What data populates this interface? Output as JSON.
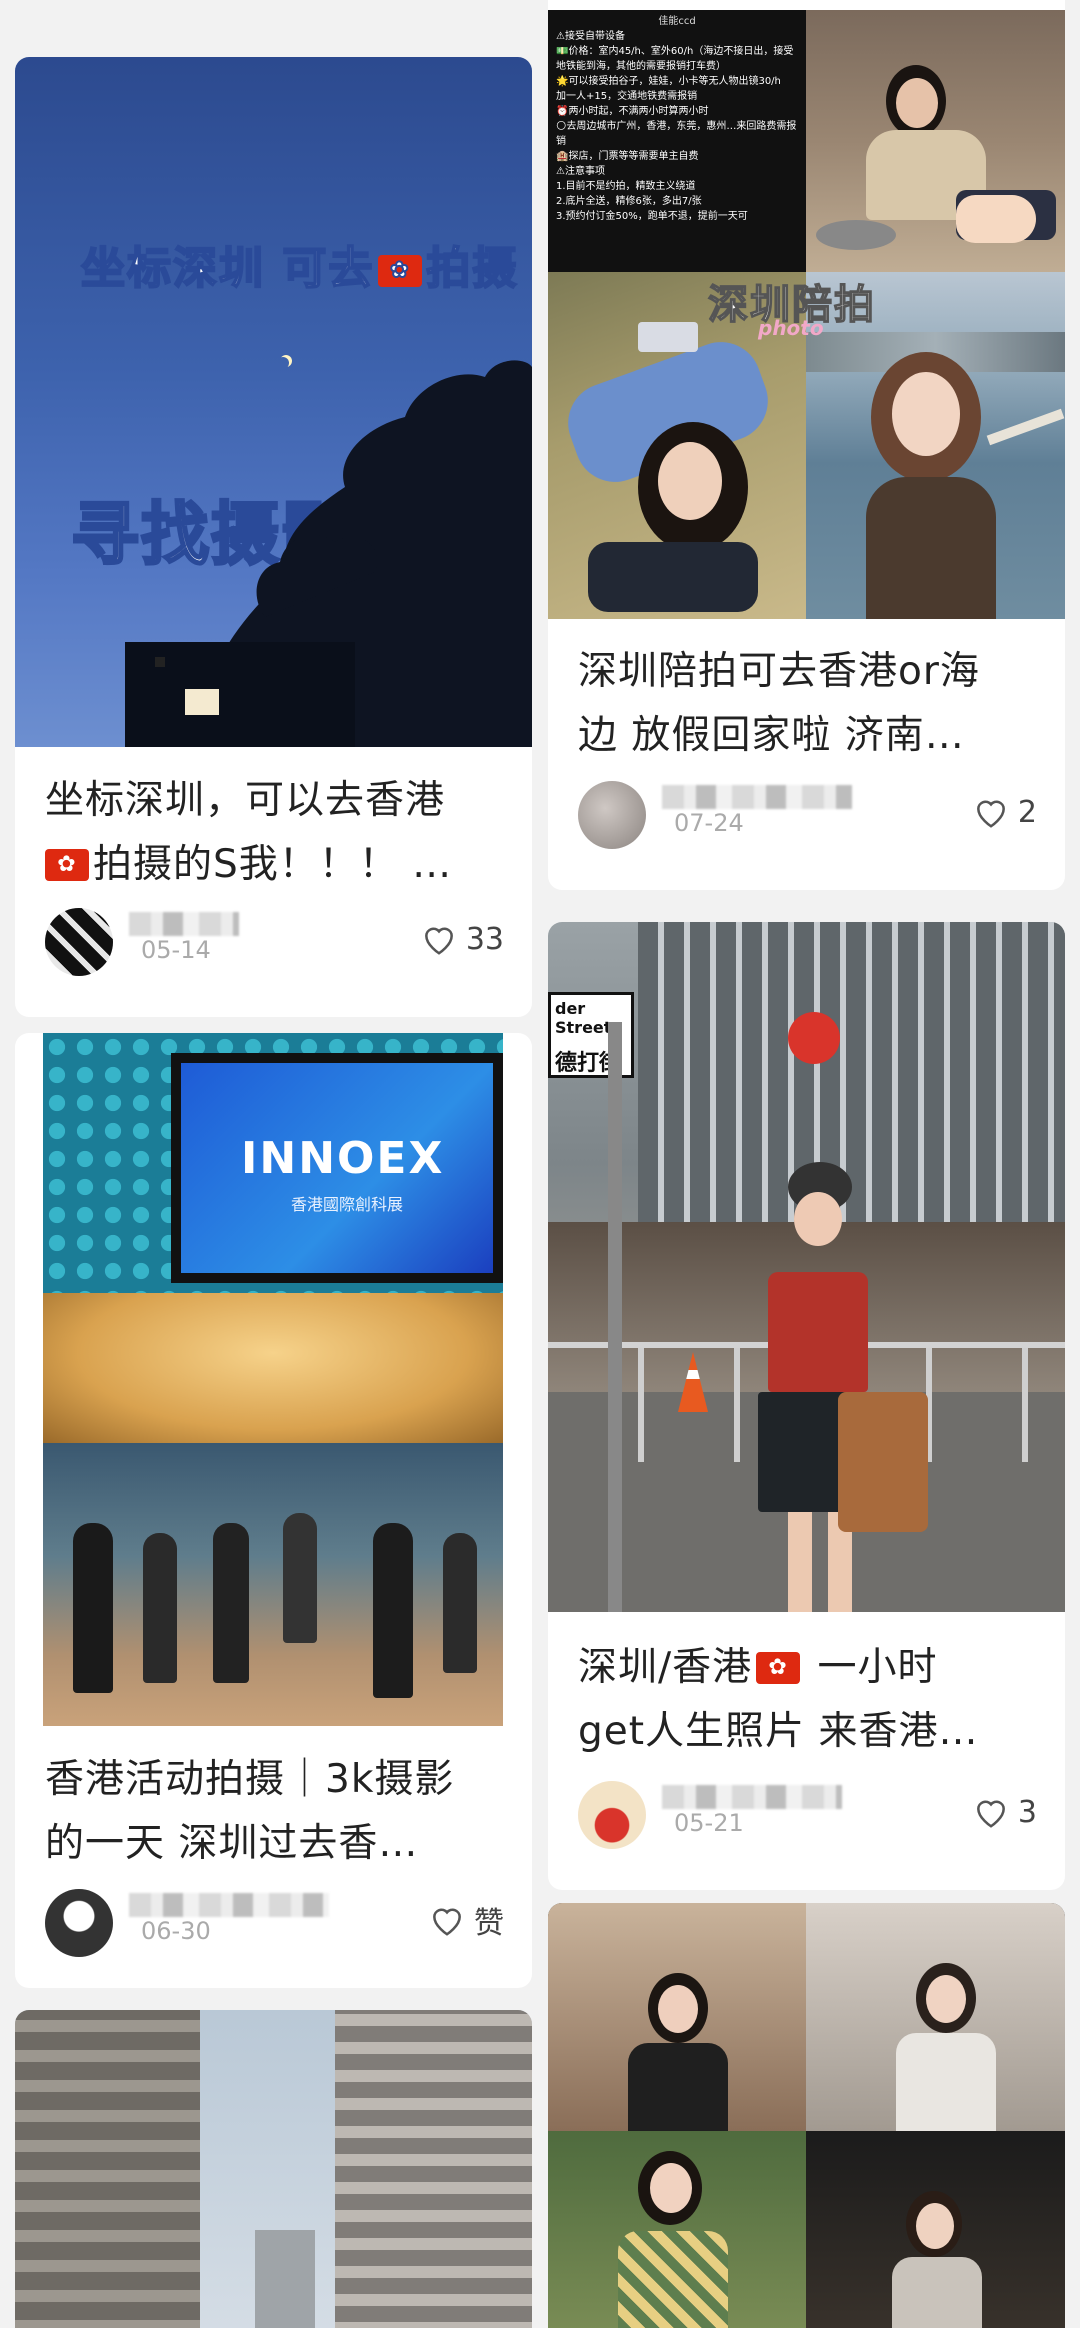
{
  "cards": [
    {
      "id": "card1",
      "cover_heading": "坐标深圳 可去",
      "cover_heading_suffix": "拍摄",
      "cover_subheading": "寻找摄影师",
      "title_line1": "坐标深圳，可以去香港",
      "title_line2": "拍摄的S我！！！ …",
      "date": "05-14",
      "likes": "33"
    },
    {
      "id": "card2",
      "cover_overlay": "深圳陪拍",
      "cover_overlay_sub": "photo",
      "cover_notes": [
        "佳能ccd",
        "⚠接受自带设备",
        "💵价格：室内45/h、室外60/h（海边不接日出，接受地铁能到海，其他的需要报销打车费）",
        "🌟可以接受拍谷子，娃娃，小卡等无人物出镜30/h",
        "加一人+15，交通地铁费需报销",
        "⏰两小时起，不满两小时算两小时",
        "🌕去周边城市广州，香港，东莞，惠州…来回路费需报销",
        "🏨探店，门票等等需要单主自费",
        "⚠注意事项",
        "1.目前不是约拍，精致主义绕道",
        "2.底片全送，精修6张，多出7/张",
        "3.预约付订金50%，跑单不退，提前一天可"
      ],
      "title_line1": "深圳陪拍可去香港or海",
      "title_line2": "边 放假回家啦 济南…",
      "date": "07-24",
      "likes": "2"
    },
    {
      "id": "card3",
      "cover_sign": "INNOEX",
      "cover_sign_sub": "香港國際創科展",
      "title_line1": "香港活动拍摄｜3k摄影",
      "title_line2": "的一天 深圳过去香…",
      "date": "06-30",
      "likes": "赞"
    },
    {
      "id": "card4",
      "cover_street_sign": "der Street",
      "cover_street_sign_cn": "德打街",
      "title_line1": "深圳/香港",
      "title_line1_suffix": " 一小时",
      "title_line2": "get人生照片 来香港…",
      "date": "05-21",
      "likes": "3"
    },
    {
      "id": "card5"
    },
    {
      "id": "card6"
    }
  ],
  "colors": {
    "background": "#f2f2f2",
    "card": "#ffffff",
    "hk_flag_red": "#de2910",
    "text_primary": "#222222",
    "text_muted": "#aaaaaa"
  }
}
